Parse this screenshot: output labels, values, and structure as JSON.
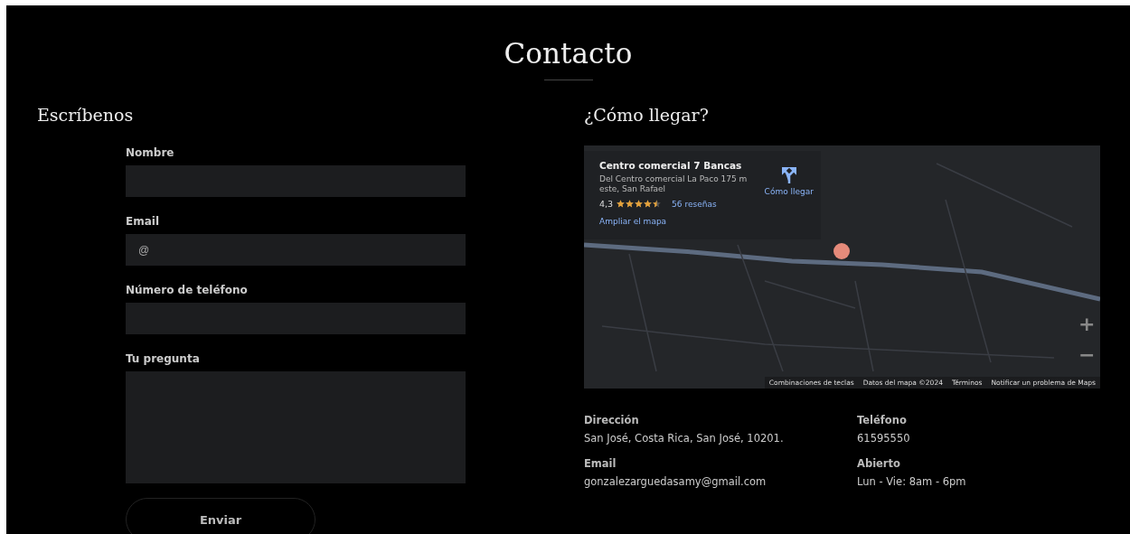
{
  "title": "Contacto",
  "form": {
    "heading": "Escríbenos",
    "fields": [
      {
        "label": "Nombre",
        "kind": "text"
      },
      {
        "label": "Email",
        "kind": "text",
        "placeholder": "@"
      },
      {
        "label": "Número de teléfono",
        "kind": "text"
      },
      {
        "label": "Tu pregunta",
        "kind": "textarea"
      }
    ],
    "submit": "Enviar"
  },
  "location": {
    "heading": "¿Cómo llegar?",
    "map": {
      "place_card": {
        "name": "Centro comercial 7 Bancas",
        "address": "Del Centro comercial La Paco 175 m este, San Rafael",
        "rating": "4,3",
        "stars": 4.5,
        "reviews": "56 reseñas",
        "enlarge": "Ampliar el mapa",
        "directions": "Cómo llegar"
      },
      "zoom_in": "+",
      "zoom_out": "−",
      "footer": [
        "Combinaciones de teclas",
        "Datos del mapa ©2024",
        "Términos",
        "Notificar un problema de Maps"
      ]
    },
    "info": [
      {
        "label": "Dirección",
        "value": "San José, Costa Rica, San José, 10201."
      },
      {
        "label": "Teléfono",
        "value": "61595550"
      },
      {
        "label": "Email",
        "value": "gonzalezarguedasamy@gmail.com"
      },
      {
        "label": "Abierto",
        "value": "Lun - Vie: 8am - 6pm"
      }
    ]
  }
}
